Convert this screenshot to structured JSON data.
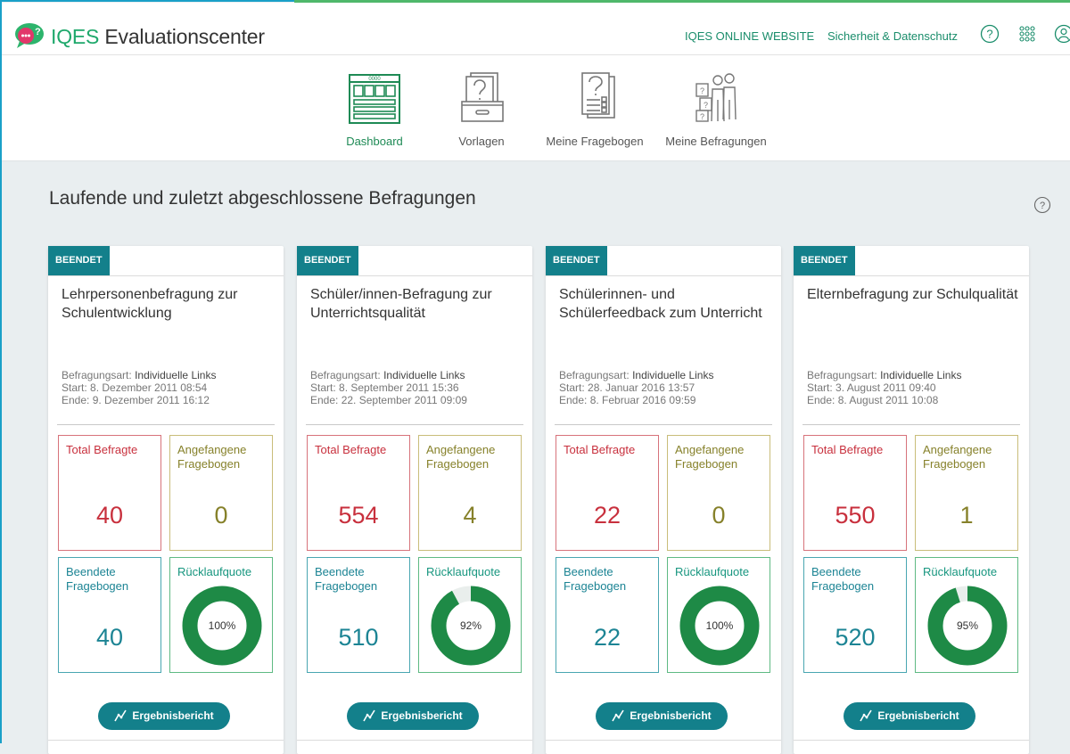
{
  "header": {
    "brand_prefix": "IQES",
    "brand_suffix": "Evaluationscenter",
    "links": [
      "IQES ONLINE WEBSITE",
      "Sicherheit & Datenschutz"
    ],
    "icons": [
      "help-icon",
      "apps-grid-icon",
      "user-icon"
    ]
  },
  "nav": {
    "items": [
      {
        "label": "Dashboard",
        "icon": "dashboard-icon",
        "active": true
      },
      {
        "label": "Vorlagen",
        "icon": "templates-icon",
        "active": false
      },
      {
        "label": "Meine Fragebogen",
        "icon": "questionnaires-icon",
        "active": false
      },
      {
        "label": "Meine Befragungen",
        "icon": "surveys-icon",
        "active": false
      }
    ]
  },
  "section": {
    "title": "Laufende und zuletzt abgeschlossene Befragungen"
  },
  "labels": {
    "type": "Befragungsart:",
    "start": "Start:",
    "end": "Ende:",
    "total": "Total Befragte",
    "started": "Angefangene Fragebogen",
    "finished": "Beendete Fragebogen",
    "rate": "Rücklaufquote",
    "report_button": "Ergebnisbericht"
  },
  "cards": [
    {
      "status": "BEENDET",
      "title": "Lehrpersonenbefragung zur Schulentwicklung",
      "type": "Individuelle Links",
      "start": "8. Dezember 2011 08:54",
      "end": "9. Dezember 2011 16:12",
      "total": "40",
      "started": "0",
      "finished": "40",
      "rate": 100,
      "rate_label": "100%"
    },
    {
      "status": "BEENDET",
      "title": "Schüler/innen-Befragung zur Unterrichtsqualität",
      "type": "Individuelle Links",
      "start": "8. September 2011 15:36",
      "end": "22. September 2011 09:09",
      "total": "554",
      "started": "4",
      "finished": "510",
      "rate": 92,
      "rate_label": "92%"
    },
    {
      "status": "BEENDET",
      "title": "Schülerinnen- und Schülerfeedback zum Unterricht",
      "type": "Individuelle Links",
      "start": "28. Januar 2016 13:57",
      "end": "8. Februar 2016 09:59",
      "total": "22",
      "started": "0",
      "finished": "22",
      "rate": 100,
      "rate_label": "100%"
    },
    {
      "status": "BEENDET",
      "title": "Elternbefragung zur Schulqualität",
      "type": "Individuelle Links",
      "start": "3. August 2011 09:40",
      "end": "8. August 2011 10:08",
      "total": "550",
      "started": "1",
      "finished": "520",
      "rate": 95,
      "rate_label": "95%"
    }
  ],
  "colors": {
    "accent": "#13808b",
    "brand_green": "#1ea86b",
    "total": "#c8303d",
    "started": "#86812a",
    "finished": "#1c8494",
    "rate": "#1e8a46"
  }
}
